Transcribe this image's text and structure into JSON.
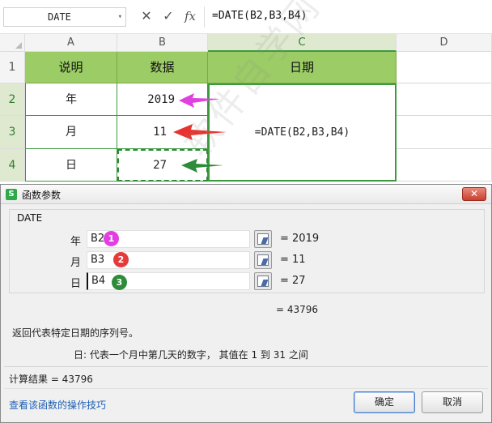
{
  "formula_bar": {
    "name_box": "DATE",
    "cancel_icon": "✕",
    "confirm_icon": "✓",
    "fx_icon": "fx",
    "formula": "=DATE(B2,B3,B4)"
  },
  "grid": {
    "columns": [
      "A",
      "B",
      "C",
      "D"
    ],
    "rows": [
      "1",
      "2",
      "3",
      "4"
    ],
    "header_row": {
      "a": "说明",
      "b": "数据",
      "c": "日期"
    },
    "data_rows": [
      {
        "a": "年",
        "b": "2019"
      },
      {
        "a": "月",
        "b": "11"
      },
      {
        "a": "日",
        "b": "27"
      }
    ],
    "merged_formula": "=DATE(B2,B3,B4)",
    "arrow_colors": [
      "#e040e0",
      "#e8332e",
      "#2e8b3a"
    ]
  },
  "dialog": {
    "title": "函数参数",
    "app_logo": "S",
    "close": "✕",
    "function_name": "DATE",
    "args": [
      {
        "label": "年",
        "value": "B2",
        "result": "= 2019",
        "badge": "1",
        "badge_color": "#e23fe2"
      },
      {
        "label": "月",
        "value": "B3",
        "result": "= 11",
        "badge": "2",
        "badge_color": "#e33b3b"
      },
      {
        "label": "日",
        "value": "B4",
        "result": "= 27",
        "badge": "3",
        "badge_color": "#2e8b3a"
      }
    ],
    "total": "= 43796",
    "description": "返回代表特定日期的序列号。",
    "arg_description": "日:  代表一个月中第几天的数字， 其值在 1 到 31 之间",
    "calc_result": "计算结果 = 43796",
    "help_link": "查看该函数的操作技巧",
    "ok": "确定",
    "cancel": "取消"
  },
  "watermark": "软件自学网 RJZXW.COM"
}
